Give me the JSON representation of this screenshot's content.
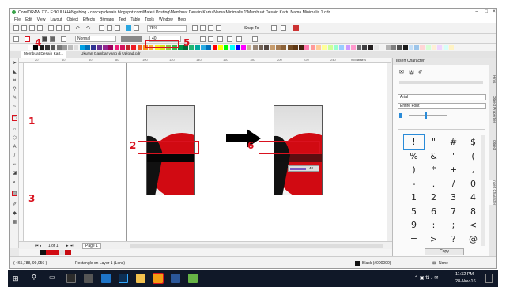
{
  "window": {
    "title": "CorelDRAW X7 - E:\\KULIAH\\Ngeblog - conceptdesain.blogspot.com\\Materi Posting\\Membuat Desain Kartu Nama Minimalis 1\\Membuat Desain Kartu Nama Minimalis 1.cdr",
    "controls": [
      "–",
      "□",
      "×"
    ]
  },
  "menu": [
    "File",
    "Edit",
    "View",
    "Layout",
    "Object",
    "Effects",
    "Bitmaps",
    "Text",
    "Table",
    "Tools",
    "Window",
    "Help"
  ],
  "standard_toolbar": {
    "zoom": "75%",
    "snap_to": "Snap To"
  },
  "property_bar": {
    "mode": "Normal",
    "transparency_value": "40"
  },
  "tabs": [
    "Membuat Desain Kart...",
    "Ukuran Gambar yang di Upload.cdr"
  ],
  "ruler": {
    "unit": "millimeters",
    "ticks": [
      "20",
      "40",
      "60",
      "80",
      "100",
      "120",
      "140",
      "160",
      "180",
      "200",
      "220",
      "240",
      "260"
    ]
  },
  "canvas": {
    "slider_value": "40"
  },
  "page_nav": {
    "current": "1 of 1",
    "page_tab": "Page 1"
  },
  "status": {
    "coords": "( 465,788, 99,056 )",
    "message": "Rectangle on Layer 1 (Lens)",
    "fill": "Black (#000000)",
    "outline": "None"
  },
  "docker": {
    "title": "Insert Character",
    "font": "Arial",
    "range": "Entire Font",
    "chars": [
      "!",
      "\"",
      "#",
      "$",
      "%",
      "&",
      "'",
      "(",
      ")",
      "*",
      "+",
      ",",
      "-",
      ".",
      "/",
      "0",
      "1",
      "2",
      "3",
      "4",
      "5",
      "6",
      "7",
      "8",
      "9",
      ":",
      ";",
      "<",
      "=",
      ">",
      "?",
      "@"
    ],
    "copy_button": "Copy",
    "side_tabs": [
      "Hints",
      "Object Properties",
      "Object",
      "Insert Character"
    ]
  },
  "annotations": [
    "1",
    "2",
    "3",
    "4",
    "5",
    "6"
  ],
  "taskbar": {
    "time": "11:32 PM",
    "date": "28-Nov-16"
  },
  "colors": {
    "red": "#d10a12",
    "dark_red": "#6b0a0c",
    "black": "#111111",
    "annotation": "#d9121f",
    "taskbar": "#101828"
  }
}
